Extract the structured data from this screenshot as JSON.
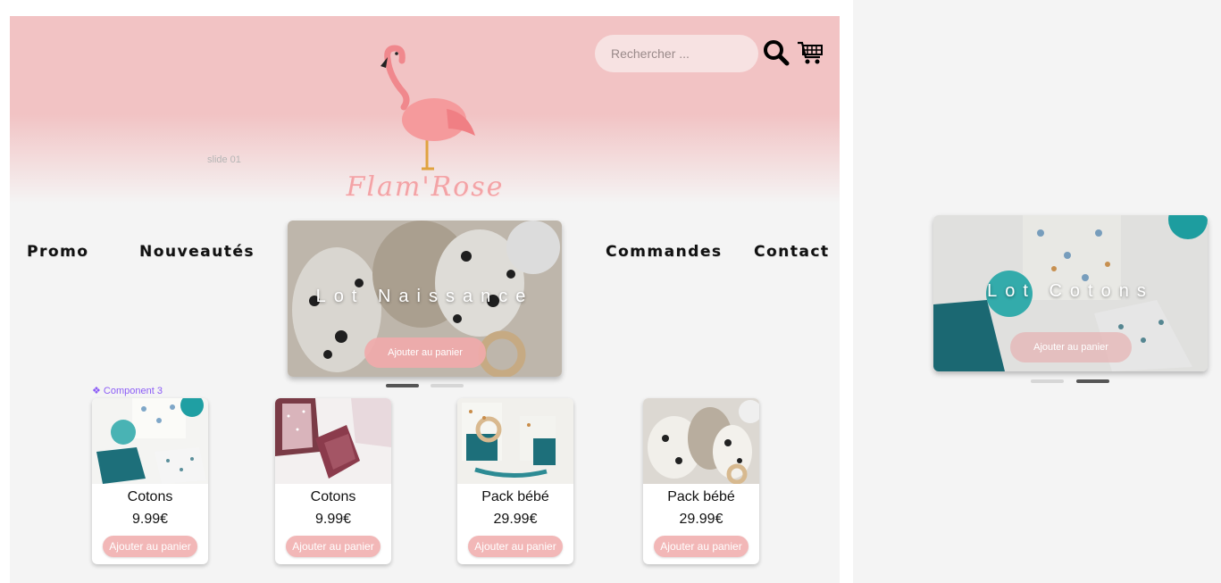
{
  "slide_label": "slide 01",
  "logo": {
    "text": "Flam'Rose"
  },
  "search": {
    "placeholder": "Rechercher ..."
  },
  "nav": [
    "Promo",
    "Nouveautés",
    "Commandes",
    "Contact"
  ],
  "carousel_main": {
    "title": "Lot Naissance",
    "button": "Ajouter au panier",
    "active_slide": 1
  },
  "carousel_side": {
    "title": "Lot Cotons",
    "button": "Ajouter au panier",
    "active_slide": 2
  },
  "component_label": "❖ Component 3",
  "products": [
    {
      "name": "Cotons",
      "price": "9.99€",
      "button": "Ajouter au panier"
    },
    {
      "name": "Cotons",
      "price": "9.99€",
      "button": "Ajouter au panier"
    },
    {
      "name": "Pack bébé",
      "price": "29.99€",
      "button": "Ajouter au panier"
    },
    {
      "name": "Pack bébé",
      "price": "29.99€",
      "button": "Ajouter au panier"
    }
  ],
  "colors": {
    "header_pink": "#f2c3c4",
    "accent_pink": "#f2b7b7",
    "logo_pink": "#f3a3a6",
    "component_purple": "#8b5cf6",
    "teal": "#1d6f7a"
  }
}
